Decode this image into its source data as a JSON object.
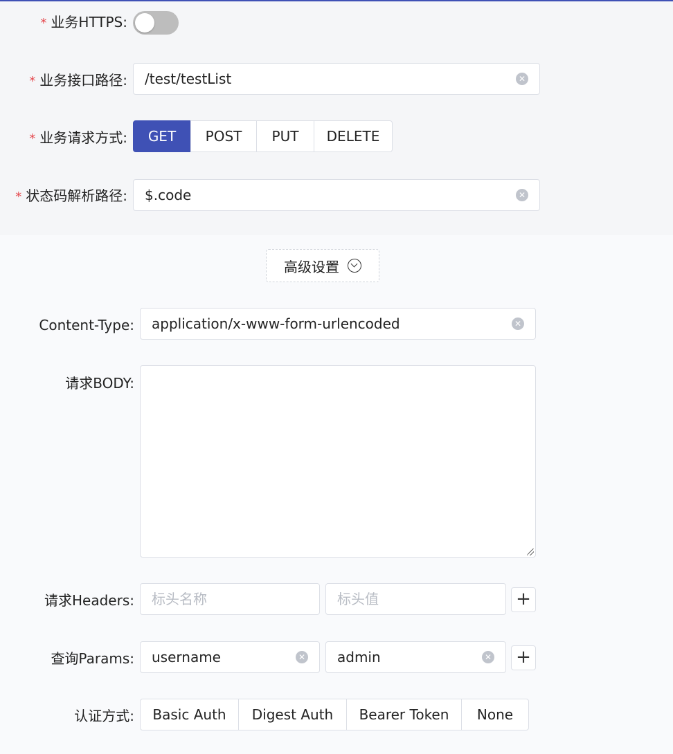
{
  "form": {
    "https_label": "业务HTTPS",
    "https_enabled": false,
    "path_label": "业务接口路径",
    "path_value": "/test/testList",
    "method_label": "业务请求方式",
    "methods": [
      "GET",
      "POST",
      "PUT",
      "DELETE"
    ],
    "method_selected": "GET",
    "status_path_label": "状态码解析路径",
    "status_path_value": "$.code",
    "colon": ":"
  },
  "advanced": {
    "toggle_label": "高级设置",
    "content_type_label": "Content-Type",
    "content_type_value": "application/x-www-form-urlencoded",
    "body_label": "请求BODY",
    "body_value": "",
    "headers_label": "请求Headers",
    "header_name_placeholder": "标头名称",
    "header_value_placeholder": "标头值",
    "params_label": "查询Params",
    "param_name": "username",
    "param_value": "admin",
    "auth_label": "认证方式",
    "auth_options": [
      "Basic Auth",
      "Digest Auth",
      "Bearer Token",
      "None"
    ]
  },
  "icons": {
    "clear": "clear-circle-icon",
    "plus": "plus-icon",
    "chevron": "chevron-down-circle-icon"
  },
  "colors": {
    "primary": "#3f51b5",
    "required": "#e5484d",
    "toggle_off": "#bdbdbd"
  }
}
